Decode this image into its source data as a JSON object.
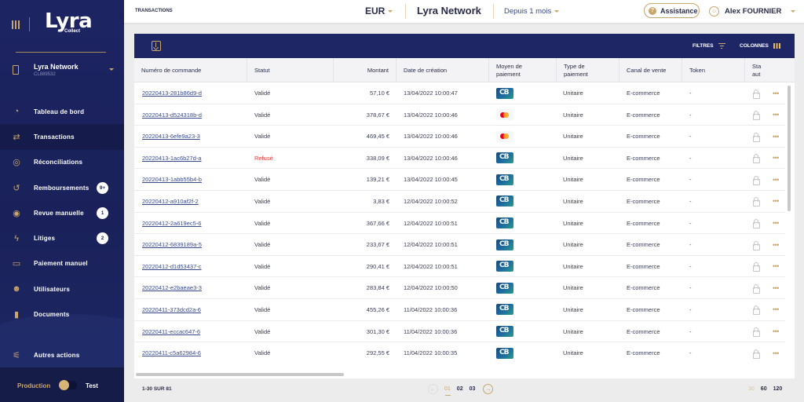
{
  "sidebar": {
    "logo": "Lyra",
    "logo_sub": "Collect",
    "merchant": {
      "name": "Lyra Network",
      "id": "CL889532"
    },
    "items": [
      {
        "label": "Tableau de bord",
        "icon": "gauge-icon",
        "badge": null,
        "active": false
      },
      {
        "label": "Transactions",
        "icon": "transfer-arrows-icon",
        "badge": null,
        "active": true
      },
      {
        "label": "Réconciliations",
        "icon": "rings-icon",
        "badge": null,
        "active": false
      },
      {
        "label": "Remboursements",
        "icon": "refund-icon",
        "badge": "9+",
        "active": false
      },
      {
        "label": "Revue manuelle",
        "icon": "eye-icon",
        "badge": "1",
        "active": false
      },
      {
        "label": "Litiges",
        "icon": "lightning-icon",
        "badge": "2",
        "active": false
      },
      {
        "label": "Paiement manuel",
        "icon": "card-icon",
        "badge": null,
        "active": false
      },
      {
        "label": "Utilisateurs",
        "icon": "users-icon",
        "badge": null,
        "active": false
      },
      {
        "label": "Documents",
        "icon": "document-icon",
        "badge": null,
        "active": false
      }
    ],
    "other_actions": "Autres actions",
    "env": {
      "production": "Production",
      "test": "Test"
    }
  },
  "topbar": {
    "breadcrumb": "TRANSACTIONS",
    "currency": "EUR",
    "network": "Lyra Network",
    "period": "Depuis 1 mois",
    "assistance": "Assistance",
    "user": "Alex FOURNIER"
  },
  "toolbar": {
    "filters": "FILTRES",
    "columns": "COLONNES"
  },
  "table": {
    "headers": [
      "Numéro de commande",
      "Statut",
      "Montant",
      "Date de création",
      "Moyen de paiement",
      "Type de paiement",
      "Canal de vente",
      "Token",
      "Statut autorisation"
    ],
    "header_visible": [
      "Numéro de commande",
      "Statut",
      "Montant",
      "Date de création",
      "Moyen de\npaiement",
      "Type de\npaiement",
      "Canal de vente",
      "Token",
      "Sta\naut"
    ],
    "rows": [
      {
        "order": "20220413-281b86d9-d",
        "status": "Validé",
        "amount": "57,10 €",
        "date": "13/04/2022 10:00:47",
        "method": "cb",
        "type": "Unitaire",
        "channel": "E-commerce",
        "token": "-"
      },
      {
        "order": "20220413-d524318b-d",
        "status": "Validé",
        "amount": "378,67 €",
        "date": "13/04/2022 10:00:46",
        "method": "mastercard",
        "type": "Unitaire",
        "channel": "E-commerce",
        "token": "-"
      },
      {
        "order": "20220413-6efe9a23-3",
        "status": "Validé",
        "amount": "469,45 €",
        "date": "13/04/2022 10:00:46",
        "method": "mastercard",
        "type": "Unitaire",
        "channel": "E-commerce",
        "token": "-"
      },
      {
        "order": "20220413-1ac6b27d-a",
        "status": "Refusé",
        "amount": "338,09 €",
        "date": "13/04/2022 10:00:46",
        "method": "cb",
        "type": "Unitaire",
        "channel": "E-commerce",
        "token": "-"
      },
      {
        "order": "20220413-1abb55b4-b",
        "status": "Validé",
        "amount": "139,21 €",
        "date": "13/04/2022 10:00:45",
        "method": "cb",
        "type": "Unitaire",
        "channel": "E-commerce",
        "token": "-"
      },
      {
        "order": "20220412-a910af2f-2",
        "status": "Validé",
        "amount": "3,83 €",
        "date": "12/04/2022 10:00:52",
        "method": "cb",
        "type": "Unitaire",
        "channel": "E-commerce",
        "token": "-"
      },
      {
        "order": "20220412-2a619ec5-6",
        "status": "Validé",
        "amount": "367,66 €",
        "date": "12/04/2022 10:00:51",
        "method": "cb",
        "type": "Unitaire",
        "channel": "E-commerce",
        "token": "-"
      },
      {
        "order": "20220412-6839189a-5",
        "status": "Validé",
        "amount": "233,67 €",
        "date": "12/04/2022 10:00:51",
        "method": "cb",
        "type": "Unitaire",
        "channel": "E-commerce",
        "token": "-"
      },
      {
        "order": "20220412-d1d53437-c",
        "status": "Validé",
        "amount": "290,41 €",
        "date": "12/04/2022 10:00:51",
        "method": "cb",
        "type": "Unitaire",
        "channel": "E-commerce",
        "token": "-"
      },
      {
        "order": "20220412-e2baeae3-3",
        "status": "Validé",
        "amount": "283,84 €",
        "date": "12/04/2022 10:00:50",
        "method": "cb",
        "type": "Unitaire",
        "channel": "E-commerce",
        "token": "-"
      },
      {
        "order": "20220411-373dcd2a-6",
        "status": "Validé",
        "amount": "455,26 €",
        "date": "11/04/2022 10:00:36",
        "method": "cb",
        "type": "Unitaire",
        "channel": "E-commerce",
        "token": "-"
      },
      {
        "order": "20220411-eccac647-6",
        "status": "Validé",
        "amount": "301,30 €",
        "date": "11/04/2022 10:00:36",
        "method": "cb",
        "type": "Unitaire",
        "channel": "E-commerce",
        "token": "-"
      },
      {
        "order": "20220411-c5a62984-6",
        "status": "Validé",
        "amount": "292,55 €",
        "date": "11/04/2022 10:00:35",
        "method": "cb",
        "type": "Unitaire",
        "channel": "E-commerce",
        "token": "-"
      }
    ]
  },
  "footer": {
    "count": "1-30 SUR 81",
    "pages": [
      "01",
      "02",
      "03"
    ],
    "current_page": "01",
    "per_page": [
      "30",
      "60",
      "120"
    ],
    "current_per_page": "30"
  },
  "colors": {
    "sidebar_bg": "#1c2462",
    "accent_gold": "#c9a66b",
    "table_header_bg": "#1f2666",
    "refused": "#e53935",
    "link": "#3a4a8a"
  }
}
